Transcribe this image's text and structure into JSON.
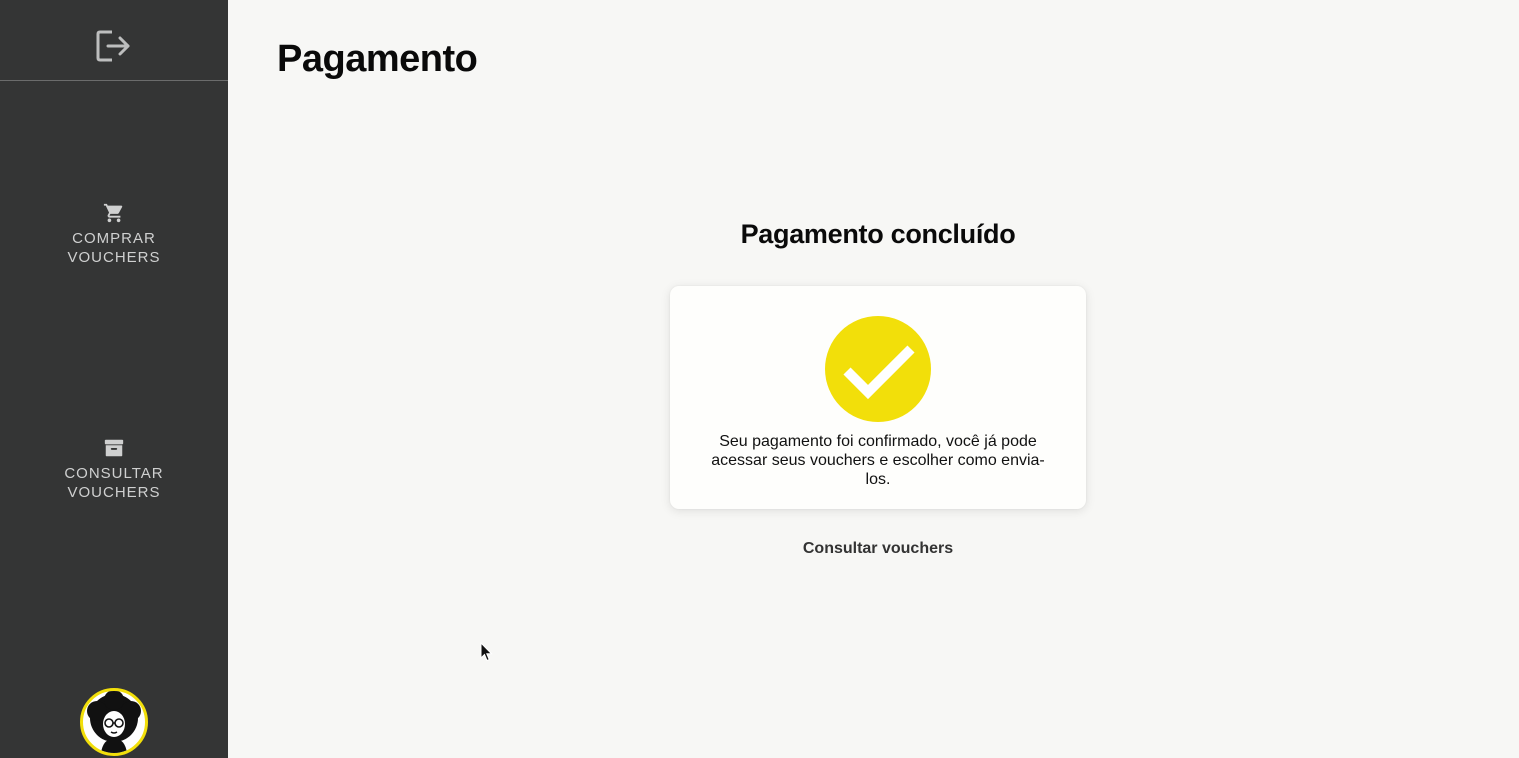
{
  "sidebar": {
    "logout_icon": "logout-icon",
    "items": [
      {
        "label": "COMPRAR VOUCHERS",
        "icon": "shopping-cart-icon"
      },
      {
        "label": "CONSULTAR VOUCHERS",
        "icon": "archive-box-icon"
      }
    ],
    "avatar_icon": "user-avatar"
  },
  "main": {
    "title": "Pagamento",
    "section_title": "Pagamento concluído",
    "card": {
      "icon": "check-circle-icon",
      "message": "Seu pagamento foi confirmado, você já pode acessar seus vouchers e escolher como envia-los."
    },
    "link_label": "Consultar vouchers"
  },
  "colors": {
    "sidebar_bg": "#343535",
    "page_bg": "#f7f7f5",
    "accent_yellow": "#f2df0a",
    "sidebar_text": "#cfd0d0"
  }
}
